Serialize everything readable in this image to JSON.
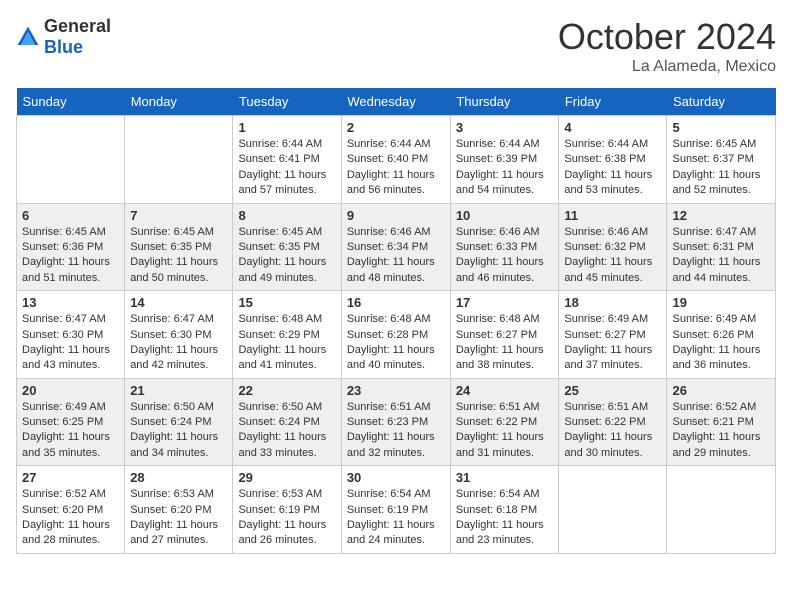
{
  "logo": {
    "general": "General",
    "blue": "Blue"
  },
  "header": {
    "month": "October 2024",
    "location": "La Alameda, Mexico"
  },
  "weekdays": [
    "Sunday",
    "Monday",
    "Tuesday",
    "Wednesday",
    "Thursday",
    "Friday",
    "Saturday"
  ],
  "weeks": [
    [
      {
        "day": "",
        "sunrise": "",
        "sunset": "",
        "daylight": ""
      },
      {
        "day": "",
        "sunrise": "",
        "sunset": "",
        "daylight": ""
      },
      {
        "day": "1",
        "sunrise": "Sunrise: 6:44 AM",
        "sunset": "Sunset: 6:41 PM",
        "daylight": "Daylight: 11 hours and 57 minutes."
      },
      {
        "day": "2",
        "sunrise": "Sunrise: 6:44 AM",
        "sunset": "Sunset: 6:40 PM",
        "daylight": "Daylight: 11 hours and 56 minutes."
      },
      {
        "day": "3",
        "sunrise": "Sunrise: 6:44 AM",
        "sunset": "Sunset: 6:39 PM",
        "daylight": "Daylight: 11 hours and 54 minutes."
      },
      {
        "day": "4",
        "sunrise": "Sunrise: 6:44 AM",
        "sunset": "Sunset: 6:38 PM",
        "daylight": "Daylight: 11 hours and 53 minutes."
      },
      {
        "day": "5",
        "sunrise": "Sunrise: 6:45 AM",
        "sunset": "Sunset: 6:37 PM",
        "daylight": "Daylight: 11 hours and 52 minutes."
      }
    ],
    [
      {
        "day": "6",
        "sunrise": "Sunrise: 6:45 AM",
        "sunset": "Sunset: 6:36 PM",
        "daylight": "Daylight: 11 hours and 51 minutes."
      },
      {
        "day": "7",
        "sunrise": "Sunrise: 6:45 AM",
        "sunset": "Sunset: 6:35 PM",
        "daylight": "Daylight: 11 hours and 50 minutes."
      },
      {
        "day": "8",
        "sunrise": "Sunrise: 6:45 AM",
        "sunset": "Sunset: 6:35 PM",
        "daylight": "Daylight: 11 hours and 49 minutes."
      },
      {
        "day": "9",
        "sunrise": "Sunrise: 6:46 AM",
        "sunset": "Sunset: 6:34 PM",
        "daylight": "Daylight: 11 hours and 48 minutes."
      },
      {
        "day": "10",
        "sunrise": "Sunrise: 6:46 AM",
        "sunset": "Sunset: 6:33 PM",
        "daylight": "Daylight: 11 hours and 46 minutes."
      },
      {
        "day": "11",
        "sunrise": "Sunrise: 6:46 AM",
        "sunset": "Sunset: 6:32 PM",
        "daylight": "Daylight: 11 hours and 45 minutes."
      },
      {
        "day": "12",
        "sunrise": "Sunrise: 6:47 AM",
        "sunset": "Sunset: 6:31 PM",
        "daylight": "Daylight: 11 hours and 44 minutes."
      }
    ],
    [
      {
        "day": "13",
        "sunrise": "Sunrise: 6:47 AM",
        "sunset": "Sunset: 6:30 PM",
        "daylight": "Daylight: 11 hours and 43 minutes."
      },
      {
        "day": "14",
        "sunrise": "Sunrise: 6:47 AM",
        "sunset": "Sunset: 6:30 PM",
        "daylight": "Daylight: 11 hours and 42 minutes."
      },
      {
        "day": "15",
        "sunrise": "Sunrise: 6:48 AM",
        "sunset": "Sunset: 6:29 PM",
        "daylight": "Daylight: 11 hours and 41 minutes."
      },
      {
        "day": "16",
        "sunrise": "Sunrise: 6:48 AM",
        "sunset": "Sunset: 6:28 PM",
        "daylight": "Daylight: 11 hours and 40 minutes."
      },
      {
        "day": "17",
        "sunrise": "Sunrise: 6:48 AM",
        "sunset": "Sunset: 6:27 PM",
        "daylight": "Daylight: 11 hours and 38 minutes."
      },
      {
        "day": "18",
        "sunrise": "Sunrise: 6:49 AM",
        "sunset": "Sunset: 6:27 PM",
        "daylight": "Daylight: 11 hours and 37 minutes."
      },
      {
        "day": "19",
        "sunrise": "Sunrise: 6:49 AM",
        "sunset": "Sunset: 6:26 PM",
        "daylight": "Daylight: 11 hours and 36 minutes."
      }
    ],
    [
      {
        "day": "20",
        "sunrise": "Sunrise: 6:49 AM",
        "sunset": "Sunset: 6:25 PM",
        "daylight": "Daylight: 11 hours and 35 minutes."
      },
      {
        "day": "21",
        "sunrise": "Sunrise: 6:50 AM",
        "sunset": "Sunset: 6:24 PM",
        "daylight": "Daylight: 11 hours and 34 minutes."
      },
      {
        "day": "22",
        "sunrise": "Sunrise: 6:50 AM",
        "sunset": "Sunset: 6:24 PM",
        "daylight": "Daylight: 11 hours and 33 minutes."
      },
      {
        "day": "23",
        "sunrise": "Sunrise: 6:51 AM",
        "sunset": "Sunset: 6:23 PM",
        "daylight": "Daylight: 11 hours and 32 minutes."
      },
      {
        "day": "24",
        "sunrise": "Sunrise: 6:51 AM",
        "sunset": "Sunset: 6:22 PM",
        "daylight": "Daylight: 11 hours and 31 minutes."
      },
      {
        "day": "25",
        "sunrise": "Sunrise: 6:51 AM",
        "sunset": "Sunset: 6:22 PM",
        "daylight": "Daylight: 11 hours and 30 minutes."
      },
      {
        "day": "26",
        "sunrise": "Sunrise: 6:52 AM",
        "sunset": "Sunset: 6:21 PM",
        "daylight": "Daylight: 11 hours and 29 minutes."
      }
    ],
    [
      {
        "day": "27",
        "sunrise": "Sunrise: 6:52 AM",
        "sunset": "Sunset: 6:20 PM",
        "daylight": "Daylight: 11 hours and 28 minutes."
      },
      {
        "day": "28",
        "sunrise": "Sunrise: 6:53 AM",
        "sunset": "Sunset: 6:20 PM",
        "daylight": "Daylight: 11 hours and 27 minutes."
      },
      {
        "day": "29",
        "sunrise": "Sunrise: 6:53 AM",
        "sunset": "Sunset: 6:19 PM",
        "daylight": "Daylight: 11 hours and 26 minutes."
      },
      {
        "day": "30",
        "sunrise": "Sunrise: 6:54 AM",
        "sunset": "Sunset: 6:19 PM",
        "daylight": "Daylight: 11 hours and 24 minutes."
      },
      {
        "day": "31",
        "sunrise": "Sunrise: 6:54 AM",
        "sunset": "Sunset: 6:18 PM",
        "daylight": "Daylight: 11 hours and 23 minutes."
      },
      {
        "day": "",
        "sunrise": "",
        "sunset": "",
        "daylight": ""
      },
      {
        "day": "",
        "sunrise": "",
        "sunset": "",
        "daylight": ""
      }
    ]
  ]
}
